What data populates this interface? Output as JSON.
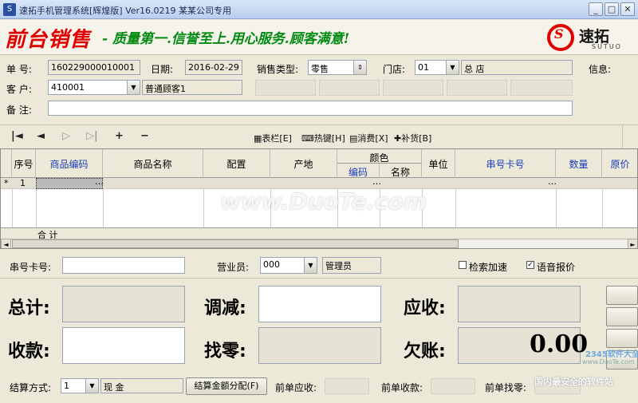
{
  "titlebar": {
    "title": "速拓手机管理系统[辉煌版] Ver16.0219   某某公司专用",
    "icon_text": "S"
  },
  "banner": {
    "slogan_left": "前台销售",
    "slogan_right": "- 质量第一.信誉至上.用心服务.顾客满意!",
    "logo_cn": "速拓",
    "logo_en": "SUTUO"
  },
  "form": {
    "order_no_label": "单  号:",
    "order_no": "160229000010001",
    "date_label": "日期:",
    "date": "2016-02-29",
    "sale_type_label": "销售类型:",
    "sale_type": "零售",
    "store_label": "门店:",
    "store_code": "01",
    "store_name": "总  店",
    "info_label": "信息:",
    "customer_label": "客  户:",
    "customer_code": "410001",
    "customer_name": "普通顾客1",
    "remark_label": "备  注:",
    "remark": ""
  },
  "toolbar": {
    "nav": [
      "|◄",
      "◄",
      "▷",
      "▷|",
      "+",
      "−"
    ],
    "table_cols": "表栏[E]",
    "hotkey": "热键[H]",
    "consume": "消费[X]",
    "replenish": "补货[B]"
  },
  "grid": {
    "headers": {
      "seq": "序号",
      "code": "商品编码",
      "name": "商品名称",
      "config": "配置",
      "origin": "产地",
      "color": "颜色",
      "color_code": "编码",
      "color_name": "名称",
      "unit": "单位",
      "serial": "串号卡号",
      "qty": "数量",
      "price": "原价"
    },
    "rows": [
      {
        "marker": "*",
        "seq": "1"
      }
    ],
    "total_label": "合  计"
  },
  "lower": {
    "serial_label": "串号卡号:",
    "serial_value": "",
    "clerk_label": "营业员:",
    "clerk_code": "000",
    "clerk_name": "管理员",
    "search_accel": "检索加速",
    "voice": "语音报价",
    "total_label": "总计:",
    "adjust_label": "调减:",
    "receivable_label": "应收:",
    "received_label": "收款:",
    "change_label": "找零:",
    "debt_label": "欠账:",
    "debt_value": "0.00",
    "pay_method_label": "结算方式:",
    "pay_method_code": "1",
    "pay_method_name": "现  金",
    "split_button": "结算金额分配(F)",
    "prev_receivable": "前单应收:",
    "prev_received": "前单收款:",
    "prev_change": "前单找零:"
  },
  "watermark": {
    "main": "www.DuoTe.com",
    "corner1": "2345软件大全",
    "corner2": "www.DuoTe.com",
    "corner3": "国内最安全的软件站"
  }
}
